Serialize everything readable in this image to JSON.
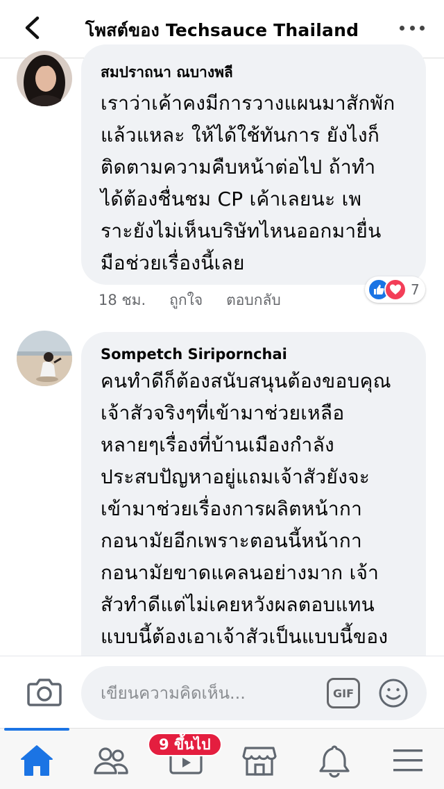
{
  "header": {
    "title": "โพสต์ของ Techsauce Thailand"
  },
  "comments": [
    {
      "name": "สมปราถนา ณบางพลี",
      "lines": [
        "เราว่าเค้าคงมีการวางแผนมาสักพัก",
        "แล้วแหละ ให้ได้ใช้ทันการ ยังไงก็",
        "ติดตามความคืบหน้าต่อไป ถ้าทำ",
        "ได้ต้องชื่นชม CP เค้าเลยนะ เพ",
        "ราะยังไม่เห็นบริษัทไหนออกมายื่น",
        "มือช่วยเรื่องนี้เลย"
      ],
      "time": "18 ชม.",
      "like_label": "ถูกใจ",
      "reply_label": "ตอบกลับ",
      "reaction_count": "7"
    },
    {
      "name": "Sompetch Siripornchai",
      "lines": [
        "คนทำดีก็ต้องสนับสนุนต้องขอบคุณ",
        "เจ้าสัวจริงๆที่เข้ามาช่วยเหลือ",
        "หลายๆเรื่องที่บ้านเมืองกำลัง",
        "ประสบปัญหาอยู่แถมเจ้าสัวยังจะ",
        "เข้ามาช่วยเรื่องการผลิตหน้ากา",
        "กอนามัยอีกเพราะตอนนี้หน้ากา",
        "กอนามัยขาดแคลนอย่างมาก เจ้า",
        "สัวทำดีแต่ไม่เคยหวังผลตอบแทน",
        "แบบนี้ต้องเอาเจ้าสัวเป็นแบบนี้ของ"
      ]
    }
  ],
  "composer": {
    "placeholder": "เขียนความคิดเห็น...",
    "gif_label": "GIF"
  },
  "bottom_nav": {
    "items": [
      "home-icon",
      "friends-icon",
      "watch-icon",
      "marketplace-icon",
      "notifications-icon",
      "menu-icon"
    ],
    "active": "home",
    "watch_badge": "9 ขึ้นไป"
  },
  "colors": {
    "accent": "#1b74e4",
    "bubble": "#f0f2f5",
    "badge": "#e41e3f",
    "love": "#f33e58"
  }
}
